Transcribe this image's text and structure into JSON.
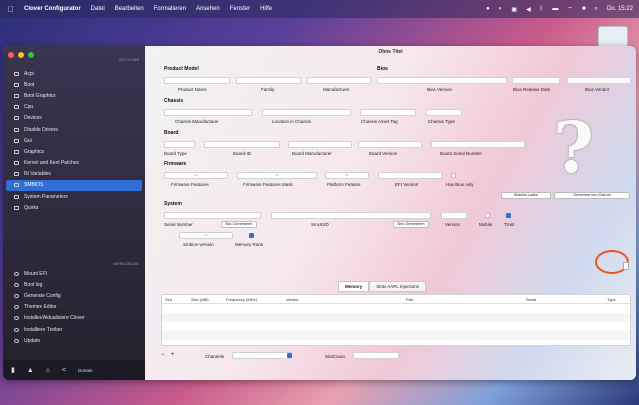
{
  "menubar": {
    "app_name": "Clover Configurator",
    "items": [
      "Datei",
      "Bearbeiten",
      "Formatieren",
      "Ansehen",
      "Fenster",
      "Hilfe"
    ],
    "clock": "Do. 15:22"
  },
  "window": {
    "title": "Ohne Titel"
  },
  "sidebar": {
    "section_sections": "SECTIONS",
    "section_tools": "WERKZEUGE",
    "sections": [
      {
        "label": "Acpi",
        "selected": false
      },
      {
        "label": "Boot",
        "selected": false
      },
      {
        "label": "Boot Graphics",
        "selected": false
      },
      {
        "label": "Cpu",
        "selected": false
      },
      {
        "label": "Devices",
        "selected": false
      },
      {
        "label": "Disable Drivers",
        "selected": false
      },
      {
        "label": "Gui",
        "selected": false
      },
      {
        "label": "Graphics",
        "selected": false
      },
      {
        "label": "Kernel and Kext Patches",
        "selected": false
      },
      {
        "label": "Rt Variables",
        "selected": false
      },
      {
        "label": "SMBIOS",
        "selected": true
      },
      {
        "label": "System Parameters",
        "selected": false
      },
      {
        "label": "Quirks",
        "selected": false
      }
    ],
    "tools": [
      "Mount EFI",
      "Boot log",
      "Generate Config",
      "Themes Editor",
      "Installer/Aktualisiere Clover",
      "Installiere Treiber",
      "Update"
    ],
    "bottom_donate": "Donate"
  },
  "product": {
    "group": "Product Model",
    "labels": [
      "Product Name",
      "Family",
      "Manufacturer"
    ]
  },
  "bios": {
    "group": "Bios",
    "labels": [
      "Bios Version",
      "Bios Release Date",
      "Bios Vendor"
    ]
  },
  "chassis": {
    "group": "Chassis",
    "labels": [
      "Chassis Manufacturer",
      "Location in Chassis",
      "Chassis Asset Tag",
      "Chassis Type"
    ]
  },
  "board": {
    "group": "Board",
    "labels": [
      "Board Type",
      "Board-ID",
      "Board Manufacturer",
      "Board Version",
      "Board Serial Number"
    ]
  },
  "firmware": {
    "group": "Firmware",
    "labels": [
      "Firmware Features",
      "Firmware Features Mask",
      "Platform Feature",
      "EFI Version"
    ],
    "has_bios_only": "Has Bios only"
  },
  "system": {
    "group": "System",
    "labels": [
      "Serial Number",
      "SmUUID",
      "Version",
      "Mobile",
      "Trust"
    ],
    "generate": "Neu Generieren",
    "smbios_version": "Smbios version",
    "memory_rank": "Memory Rank"
  },
  "buttons": {
    "smbios_loader": "Smbios Laden",
    "generate_new": "Generiere neu Cstruct"
  },
  "tabs": [
    {
      "label": "Memory",
      "selected": true
    },
    {
      "label": "Slots AAPL Injections",
      "selected": false
    }
  ],
  "table": {
    "columns": [
      "Slot",
      "Size (MB)",
      "Frequency (MHz)",
      "Vendor",
      "Part",
      "Serial",
      "Type"
    ],
    "rows": []
  },
  "footer": {
    "add": "+",
    "remove": "−",
    "channels_label": "Channels",
    "slotcount_label": "SlotCount"
  },
  "colors": {
    "accent": "#2f6fd6",
    "sidebar_bg": "#2c2838",
    "annotation": "#e8551f"
  },
  "icons": {
    "placeholder": "question-mark-icon"
  }
}
